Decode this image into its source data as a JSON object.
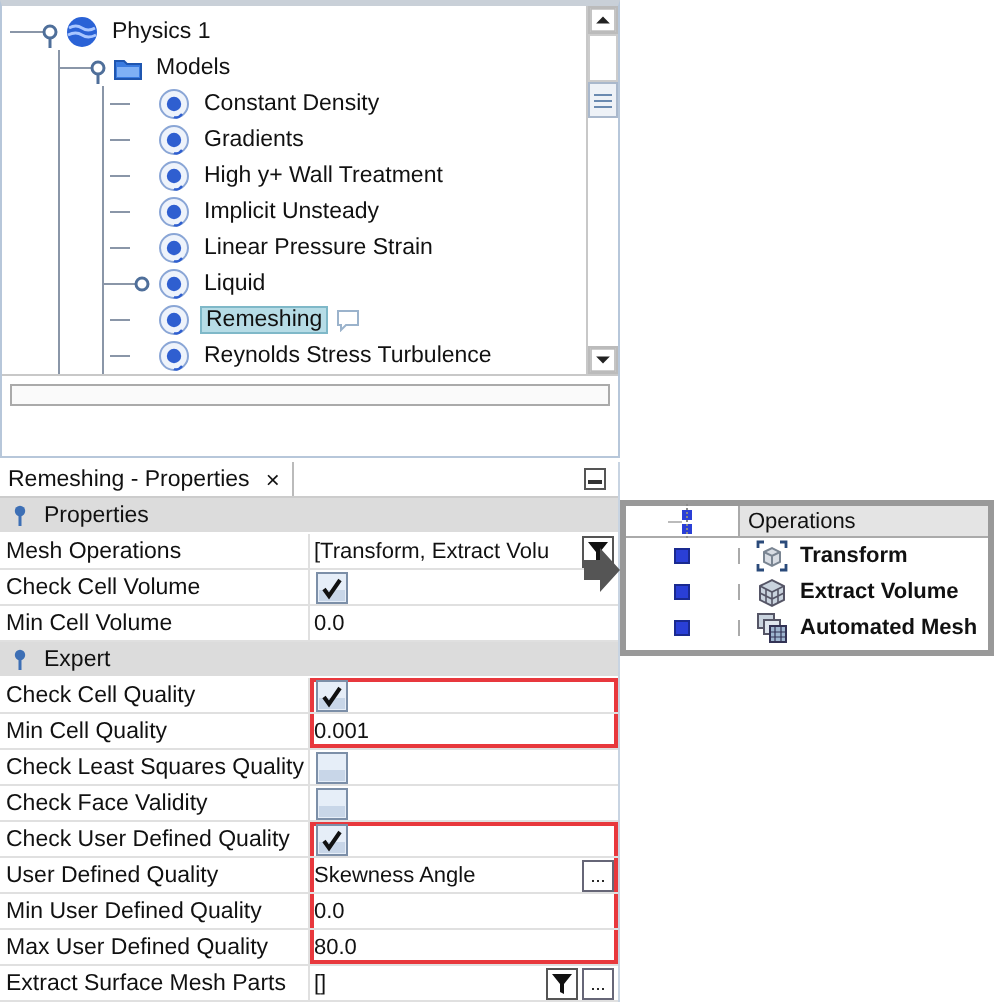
{
  "tree": {
    "items": [
      {
        "label": "Physics 1",
        "kind": "physics",
        "expanded": true,
        "children": [
          {
            "label": "Models",
            "kind": "folder",
            "expanded": true,
            "children": [
              {
                "label": "Constant Density",
                "kind": "model",
                "has_children": false,
                "selected": false,
                "comment": false
              },
              {
                "label": "Gradients",
                "kind": "model",
                "has_children": false,
                "selected": false,
                "comment": false
              },
              {
                "label": "High y+ Wall Treatment",
                "kind": "model",
                "has_children": false,
                "selected": false,
                "comment": false
              },
              {
                "label": "Implicit Unsteady",
                "kind": "model",
                "has_children": false,
                "selected": false,
                "comment": false
              },
              {
                "label": "Linear Pressure Strain",
                "kind": "model",
                "has_children": false,
                "selected": false,
                "comment": false
              },
              {
                "label": "Liquid",
                "kind": "model",
                "has_children": true,
                "selected": false,
                "comment": false
              },
              {
                "label": "Remeshing",
                "kind": "model",
                "has_children": false,
                "selected": true,
                "comment": true
              },
              {
                "label": "Reynolds Stress Turbulence",
                "kind": "model",
                "has_children": false,
                "selected": false,
                "comment": false
              }
            ]
          }
        ]
      }
    ]
  },
  "properties": {
    "tab": {
      "label": "Remeshing - Properties",
      "close": "×"
    },
    "rows": [
      {
        "kind": "section",
        "label": "Properties"
      },
      {
        "kind": "list",
        "label": "Mesh Operations",
        "value": "[Transform, Extract Volu",
        "outlined": false
      },
      {
        "kind": "checkbox",
        "label": "Check Cell Volume",
        "checked": true,
        "outlined": false
      },
      {
        "kind": "text",
        "label": "Min Cell Volume",
        "value": "0.0",
        "outlined": false
      },
      {
        "kind": "section",
        "label": "Expert"
      },
      {
        "kind": "checkbox",
        "label": "Check Cell Quality",
        "checked": true,
        "outlined": true
      },
      {
        "kind": "text",
        "label": "Min Cell Quality",
        "value": "0.001",
        "outlined": true
      },
      {
        "kind": "checkbox",
        "label": "Check Least Squares Quality",
        "checked": false,
        "outlined": false
      },
      {
        "kind": "checkbox",
        "label": "Check Face Validity",
        "checked": false,
        "outlined": false
      },
      {
        "kind": "checkbox",
        "label": "Check User Defined Quality",
        "checked": true,
        "outlined": true
      },
      {
        "kind": "choice",
        "label": "User Defined Quality",
        "value": "Skewness Angle",
        "more": "...",
        "outlined": true
      },
      {
        "kind": "text",
        "label": "Min User Defined Quality",
        "value": "0.0",
        "outlined": true
      },
      {
        "kind": "text",
        "label": "Max User Defined Quality",
        "value": "80.0",
        "outlined": true
      },
      {
        "kind": "list",
        "label": "Extract Surface Mesh Parts",
        "value": "[]",
        "more": "...",
        "outlined": false
      }
    ]
  },
  "popup": {
    "title": "Operations",
    "items": [
      {
        "label": "Transform",
        "kind": "transform"
      },
      {
        "label": "Extract Volume",
        "kind": "extract"
      },
      {
        "label": "Automated Mesh",
        "kind": "mesh"
      }
    ]
  }
}
